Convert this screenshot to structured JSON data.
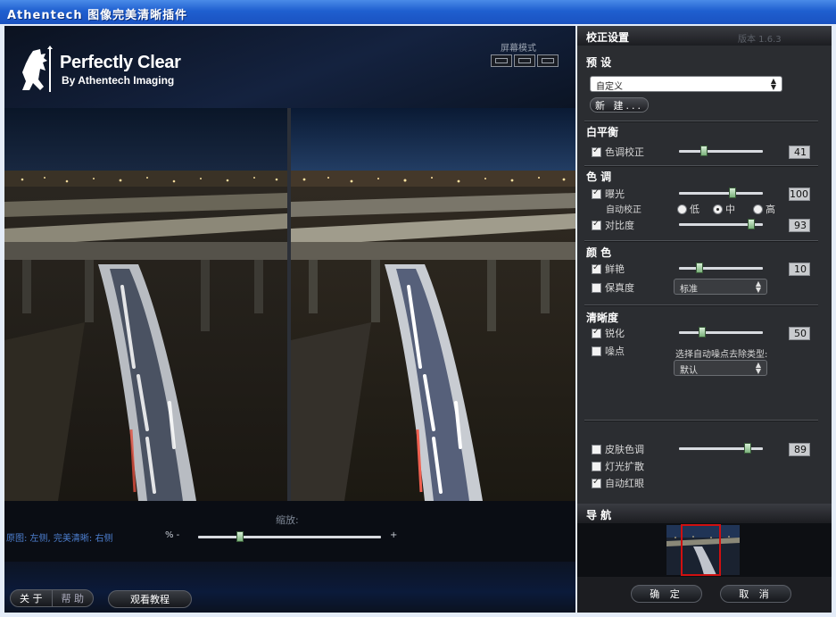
{
  "window": {
    "title": "Athentech 图像完美清晰插件"
  },
  "header": {
    "brand_title": "Perfectly Clear",
    "brand_subtitle": "By Athentech Imaging",
    "screen_mode_label": "屏幕模式",
    "screen_modes": [
      "single-view-icon",
      "split-view-icon",
      "compare-view-icon"
    ]
  },
  "preview": {
    "zoom_label": "缩放:",
    "caption": "原图: 左侧, 完美清晰: 右侧",
    "zoom_prefix": "% -",
    "zoom_suffix": "+",
    "zoom_level": 0.22
  },
  "footer_left": {
    "about_label": "关 于",
    "help_label": "帮 助",
    "tutorial_label": "观看教程"
  },
  "panel": {
    "title": "校正设置",
    "version": "版本 1.6.3",
    "presets": {
      "heading": "预 设",
      "selected": "自定义",
      "new_label": "新 建..."
    },
    "white_balance": {
      "heading": "白平衡",
      "tint": {
        "label": "色调校正",
        "checked": true,
        "value": "41",
        "level": 0.28
      }
    },
    "tone": {
      "heading": "色 调",
      "exposure": {
        "label": "曝光",
        "checked": true,
        "value": "100",
        "level": 0.65
      },
      "auto_correct_label": "自动校正",
      "auto_options": [
        "低",
        "中",
        "高"
      ],
      "auto_selected": 1,
      "contrast": {
        "label": "对比度",
        "checked": true,
        "value": "93",
        "level": 0.9
      }
    },
    "color": {
      "heading": "颜 色",
      "vibrance": {
        "label": "鲜艳",
        "checked": true,
        "value": "10",
        "level": 0.22
      },
      "fidelity": {
        "label": "保真度",
        "checked": false,
        "selected": "标准"
      }
    },
    "sharpness": {
      "heading": "清晰度",
      "sharpen": {
        "label": "锐化",
        "checked": true,
        "value": "50",
        "level": 0.25
      },
      "noise": {
        "label": "噪点",
        "checked": false
      },
      "noise_type_label": "选择自动噪点去除类型:",
      "noise_type_selected": "默认"
    },
    "extras": {
      "skin": {
        "label": "皮肤色调",
        "checked": false,
        "value": "89",
        "level": 0.85
      },
      "light_diffusion": {
        "label": "灯光扩散",
        "checked": false
      },
      "red_eye": {
        "label": "自动红眼",
        "checked": true
      }
    },
    "navigator_label": "导 航",
    "ok_label": "确 定",
    "cancel_label": "取 消"
  },
  "colors": {
    "accent": "#1f5fd0",
    "panel": "#2b2d31",
    "nav_frame": "#d01010"
  }
}
